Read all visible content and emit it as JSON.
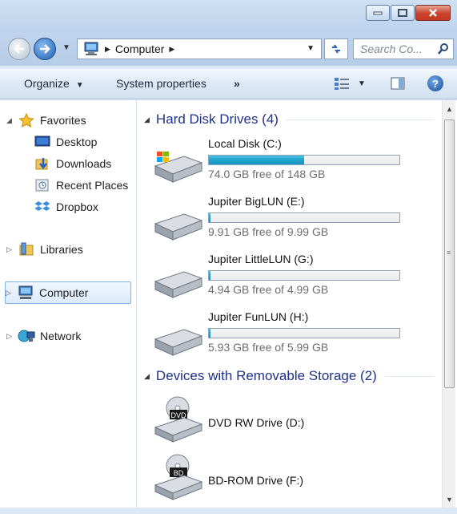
{
  "window": {
    "minimize_icon": "minimize-icon",
    "maximize_icon": "maximize-icon",
    "close_icon": "close-icon"
  },
  "address_bar": {
    "location": "Computer",
    "search_placeholder": "Search Co..."
  },
  "command_bar": {
    "organize": "Organize",
    "system_properties": "System properties",
    "more": "»",
    "help": "?"
  },
  "nav_pane": {
    "favorites": "Favorites",
    "favorites_items": [
      {
        "label": "Desktop",
        "icon": "desktop-icon"
      },
      {
        "label": "Downloads",
        "icon": "downloads-folder-icon"
      },
      {
        "label": "Recent Places",
        "icon": "recent-places-icon"
      },
      {
        "label": "Dropbox",
        "icon": "dropbox-icon"
      }
    ],
    "libraries": "Libraries",
    "computer": "Computer",
    "network": "Network"
  },
  "main": {
    "hard_disk_header": "Hard Disk Drives (4)",
    "removable_header": "Devices with Removable Storage (2)",
    "drives": [
      {
        "name": "Local Disk (C:)",
        "free_text": "74.0 GB free of 148 GB",
        "used_fraction": 0.5
      },
      {
        "name": "Jupiter BigLUN (E:)",
        "free_text": "9.91 GB free of 9.99 GB",
        "used_fraction": 0.008
      },
      {
        "name": "Jupiter LittleLUN (G:)",
        "free_text": "4.94 GB free of 4.99 GB",
        "used_fraction": 0.01
      },
      {
        "name": "Jupiter FunLUN (H:)",
        "free_text": "5.93 GB free of 5.99 GB",
        "used_fraction": 0.01
      }
    ],
    "removable": [
      {
        "name": "DVD RW Drive (D:)",
        "badge": "DVD"
      },
      {
        "name": "BD-ROM Drive (F:)",
        "badge": "BD"
      }
    ]
  },
  "colors": {
    "group_header": "#1e3287",
    "usage_fill": "#1fa3cf",
    "selection_border": "#7fb2e5"
  }
}
